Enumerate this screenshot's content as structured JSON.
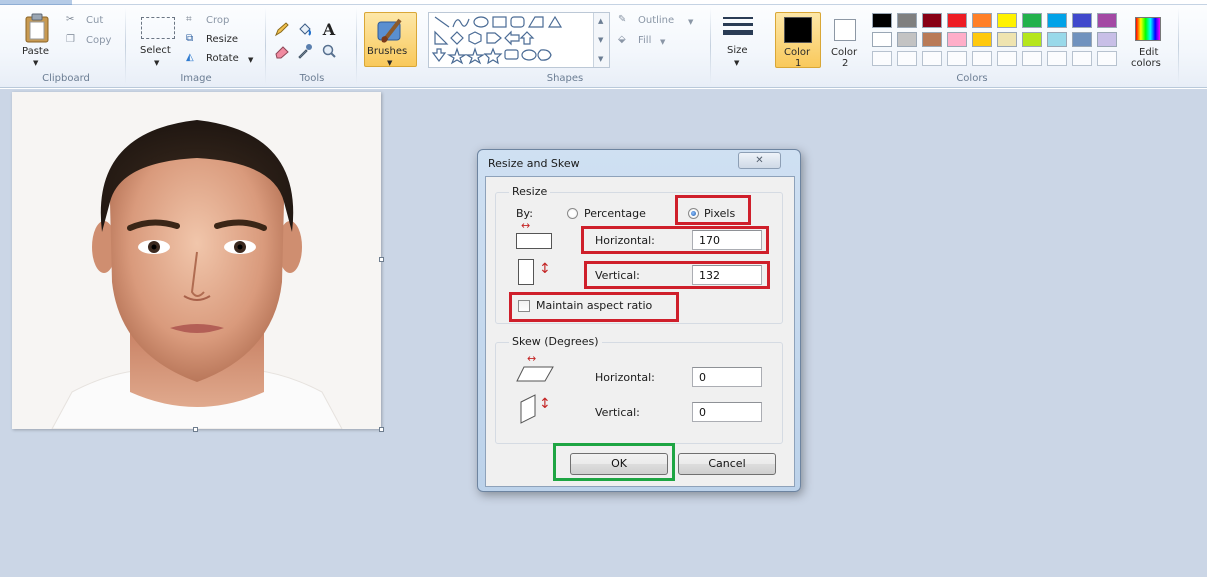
{
  "ribbon": {
    "clipboard": {
      "paste": "Paste",
      "cut": "Cut",
      "copy": "Copy",
      "group": "Clipboard"
    },
    "image": {
      "select": "Select",
      "crop": "Crop",
      "resize": "Resize",
      "rotate": "Rotate",
      "group": "Image"
    },
    "tools": {
      "group": "Tools"
    },
    "brushes": "Brushes",
    "shapes": {
      "outline": "Outline",
      "fill": "Fill",
      "group": "Shapes"
    },
    "size": "Size",
    "colors": {
      "color1": "Color",
      "color1_num": "1",
      "color2": "Color",
      "color2_num": "2",
      "edit_line1": "Edit",
      "edit_line2": "colors",
      "group": "Colors",
      "color1_value": "#000000",
      "color2_value": "#ffffff",
      "palette_row1": [
        "#000000",
        "#7f7f7f",
        "#880015",
        "#ed1c24",
        "#ff7f27",
        "#fff200",
        "#22b14c",
        "#00a2e8",
        "#3f48cc",
        "#a349a4"
      ],
      "palette_row2": [
        "#ffffff",
        "#c3c3c3",
        "#b97a57",
        "#ffaec9",
        "#ffc90e",
        "#efe4b0",
        "#b5e61d",
        "#99d9ea",
        "#7092be",
        "#c8bfe7"
      ]
    }
  },
  "dialog": {
    "title": "Resize and Skew",
    "resize": {
      "group": "Resize",
      "by": "By:",
      "percentage": "Percentage",
      "pixels": "Pixels",
      "selected": "pixels",
      "horizontal_label": "Horizontal:",
      "horizontal_value": "170",
      "vertical_label": "Vertical:",
      "vertical_value": "132",
      "maintain": "Maintain aspect ratio",
      "maintain_checked": false
    },
    "skew": {
      "group": "Skew (Degrees)",
      "horizontal_label": "Horizontal:",
      "horizontal_value": "0",
      "vertical_label": "Vertical:",
      "vertical_value": "0"
    },
    "ok": "OK",
    "cancel": "Cancel"
  },
  "annotation_colors": {
    "red": "#cf1f2b",
    "green": "#1ea543"
  }
}
